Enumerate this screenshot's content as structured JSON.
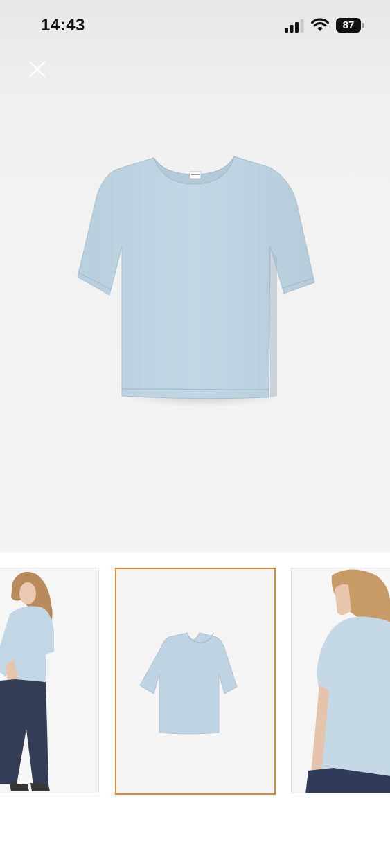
{
  "status_bar": {
    "time": "14:43",
    "battery_level": "87",
    "icons": [
      "cellular-signal-icon",
      "wifi-icon",
      "battery-icon"
    ]
  },
  "toolbar": {
    "close_icon": "close-icon"
  },
  "gallery": {
    "main_image": "t-shirt-flat-lay-front",
    "thumbnails": [
      {
        "image": "model-side-view-wearing-shirt",
        "selected": false
      },
      {
        "image": "t-shirt-flat-lay-front",
        "selected": true
      },
      {
        "image": "model-back-view-wearing-shirt",
        "selected": false
      }
    ],
    "selected_index": 1
  },
  "colors": {
    "product": "#bcd2e0",
    "selected_border": "#d68a3a",
    "background": "#f3f2f2"
  }
}
